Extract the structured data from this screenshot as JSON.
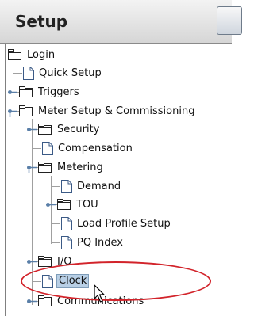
{
  "header": {
    "title": "Setup"
  },
  "tree": {
    "items": [
      {
        "label": "Login"
      },
      {
        "label": "Quick Setup"
      },
      {
        "label": "Triggers"
      },
      {
        "label": "Meter Setup & Commissioning"
      },
      {
        "label": "Security"
      },
      {
        "label": "Compensation"
      },
      {
        "label": "Metering"
      },
      {
        "label": "Demand"
      },
      {
        "label": "TOU"
      },
      {
        "label": "Load Profile Setup"
      },
      {
        "label": "PQ Index"
      },
      {
        "label": "I/O"
      },
      {
        "label": "Clock"
      },
      {
        "label": "Communications"
      }
    ],
    "selected": "Clock"
  },
  "annotation": {
    "highlight_color": "#d2232a"
  },
  "icons": {
    "folder": "folder-icon",
    "document": "document-icon",
    "expand": "expand-handle-icon",
    "cursor": "mouse-cursor-icon"
  }
}
